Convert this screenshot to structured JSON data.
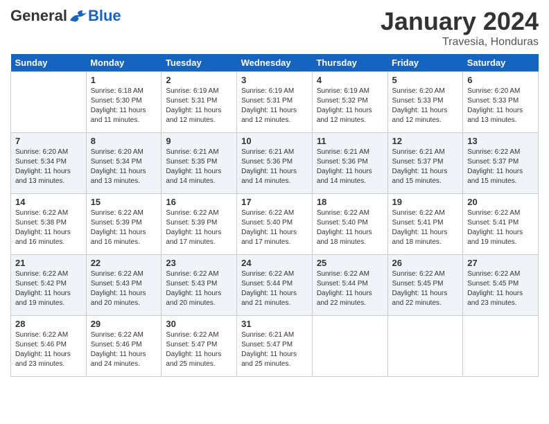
{
  "header": {
    "logo_general": "General",
    "logo_blue": "Blue",
    "month_title": "January 2024",
    "subtitle": "Travesia, Honduras"
  },
  "days_of_week": [
    "Sunday",
    "Monday",
    "Tuesday",
    "Wednesday",
    "Thursday",
    "Friday",
    "Saturday"
  ],
  "weeks": [
    [
      {
        "day": "",
        "empty": true
      },
      {
        "day": "1",
        "sunrise": "6:18 AM",
        "sunset": "5:30 PM",
        "daylight": "11 hours and 11 minutes."
      },
      {
        "day": "2",
        "sunrise": "6:19 AM",
        "sunset": "5:31 PM",
        "daylight": "11 hours and 12 minutes."
      },
      {
        "day": "3",
        "sunrise": "6:19 AM",
        "sunset": "5:31 PM",
        "daylight": "11 hours and 12 minutes."
      },
      {
        "day": "4",
        "sunrise": "6:19 AM",
        "sunset": "5:32 PM",
        "daylight": "11 hours and 12 minutes."
      },
      {
        "day": "5",
        "sunrise": "6:20 AM",
        "sunset": "5:33 PM",
        "daylight": "11 hours and 12 minutes."
      },
      {
        "day": "6",
        "sunrise": "6:20 AM",
        "sunset": "5:33 PM",
        "daylight": "11 hours and 13 minutes."
      }
    ],
    [
      {
        "day": "7",
        "sunrise": "6:20 AM",
        "sunset": "5:34 PM",
        "daylight": "11 hours and 13 minutes."
      },
      {
        "day": "8",
        "sunrise": "6:20 AM",
        "sunset": "5:34 PM",
        "daylight": "11 hours and 13 minutes."
      },
      {
        "day": "9",
        "sunrise": "6:21 AM",
        "sunset": "5:35 PM",
        "daylight": "11 hours and 14 minutes."
      },
      {
        "day": "10",
        "sunrise": "6:21 AM",
        "sunset": "5:36 PM",
        "daylight": "11 hours and 14 minutes."
      },
      {
        "day": "11",
        "sunrise": "6:21 AM",
        "sunset": "5:36 PM",
        "daylight": "11 hours and 14 minutes."
      },
      {
        "day": "12",
        "sunrise": "6:21 AM",
        "sunset": "5:37 PM",
        "daylight": "11 hours and 15 minutes."
      },
      {
        "day": "13",
        "sunrise": "6:22 AM",
        "sunset": "5:37 PM",
        "daylight": "11 hours and 15 minutes."
      }
    ],
    [
      {
        "day": "14",
        "sunrise": "6:22 AM",
        "sunset": "5:38 PM",
        "daylight": "11 hours and 16 minutes."
      },
      {
        "day": "15",
        "sunrise": "6:22 AM",
        "sunset": "5:39 PM",
        "daylight": "11 hours and 16 minutes."
      },
      {
        "day": "16",
        "sunrise": "6:22 AM",
        "sunset": "5:39 PM",
        "daylight": "11 hours and 17 minutes."
      },
      {
        "day": "17",
        "sunrise": "6:22 AM",
        "sunset": "5:40 PM",
        "daylight": "11 hours and 17 minutes."
      },
      {
        "day": "18",
        "sunrise": "6:22 AM",
        "sunset": "5:40 PM",
        "daylight": "11 hours and 18 minutes."
      },
      {
        "day": "19",
        "sunrise": "6:22 AM",
        "sunset": "5:41 PM",
        "daylight": "11 hours and 18 minutes."
      },
      {
        "day": "20",
        "sunrise": "6:22 AM",
        "sunset": "5:41 PM",
        "daylight": "11 hours and 19 minutes."
      }
    ],
    [
      {
        "day": "21",
        "sunrise": "6:22 AM",
        "sunset": "5:42 PM",
        "daylight": "11 hours and 19 minutes."
      },
      {
        "day": "22",
        "sunrise": "6:22 AM",
        "sunset": "5:43 PM",
        "daylight": "11 hours and 20 minutes."
      },
      {
        "day": "23",
        "sunrise": "6:22 AM",
        "sunset": "5:43 PM",
        "daylight": "11 hours and 20 minutes."
      },
      {
        "day": "24",
        "sunrise": "6:22 AM",
        "sunset": "5:44 PM",
        "daylight": "11 hours and 21 minutes."
      },
      {
        "day": "25",
        "sunrise": "6:22 AM",
        "sunset": "5:44 PM",
        "daylight": "11 hours and 22 minutes."
      },
      {
        "day": "26",
        "sunrise": "6:22 AM",
        "sunset": "5:45 PM",
        "daylight": "11 hours and 22 minutes."
      },
      {
        "day": "27",
        "sunrise": "6:22 AM",
        "sunset": "5:45 PM",
        "daylight": "11 hours and 23 minutes."
      }
    ],
    [
      {
        "day": "28",
        "sunrise": "6:22 AM",
        "sunset": "5:46 PM",
        "daylight": "11 hours and 23 minutes."
      },
      {
        "day": "29",
        "sunrise": "6:22 AM",
        "sunset": "5:46 PM",
        "daylight": "11 hours and 24 minutes."
      },
      {
        "day": "30",
        "sunrise": "6:22 AM",
        "sunset": "5:47 PM",
        "daylight": "11 hours and 25 minutes."
      },
      {
        "day": "31",
        "sunrise": "6:21 AM",
        "sunset": "5:47 PM",
        "daylight": "11 hours and 25 minutes."
      },
      {
        "day": "",
        "empty": true
      },
      {
        "day": "",
        "empty": true
      },
      {
        "day": "",
        "empty": true
      }
    ]
  ]
}
